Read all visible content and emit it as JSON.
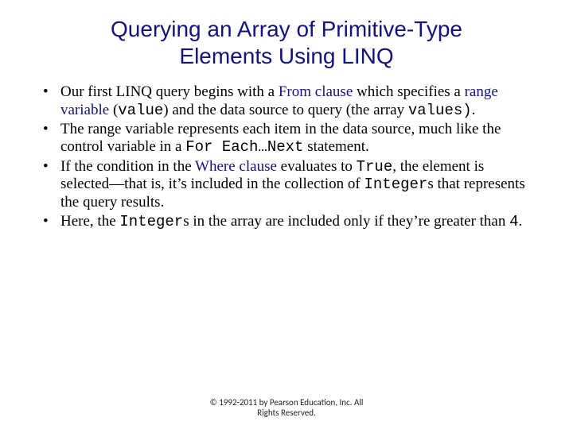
{
  "title_line1": "Querying an Array of Primitive-Type",
  "title_line2": "Elements Using LINQ",
  "bullets": {
    "b1": {
      "p1": "Our first LINQ query begins with a ",
      "from": "From clause",
      "p2": " which specifies a ",
      "rv": "range variable",
      "p3": " (",
      "code_value": "value",
      "p4": ") and the data source to query (the array ",
      "code_values": "values)",
      "p5": "."
    },
    "b2": {
      "p1": "The range variable represents each item in the data source, much like the control variable in a ",
      "code": "For Each…Next",
      "p2": " statement."
    },
    "b3": {
      "p1": "If the condition in the ",
      "where": "Where clause",
      "p2": " evaluates to ",
      "code_true": "True",
      "p3": ", the element is selected—that is, it’s included in the collection of ",
      "code_int": "Integer",
      "p4": "s that represents the query results."
    },
    "b4": {
      "p1": "Here, the ",
      "code_int": "Integer",
      "p2": "s in the array are included only if they’re greater than ",
      "code_four": "4",
      "p3": "."
    }
  },
  "footer_line1": "© 1992-2011 by Pearson Education, Inc. All",
  "footer_line2": "Rights Reserved."
}
